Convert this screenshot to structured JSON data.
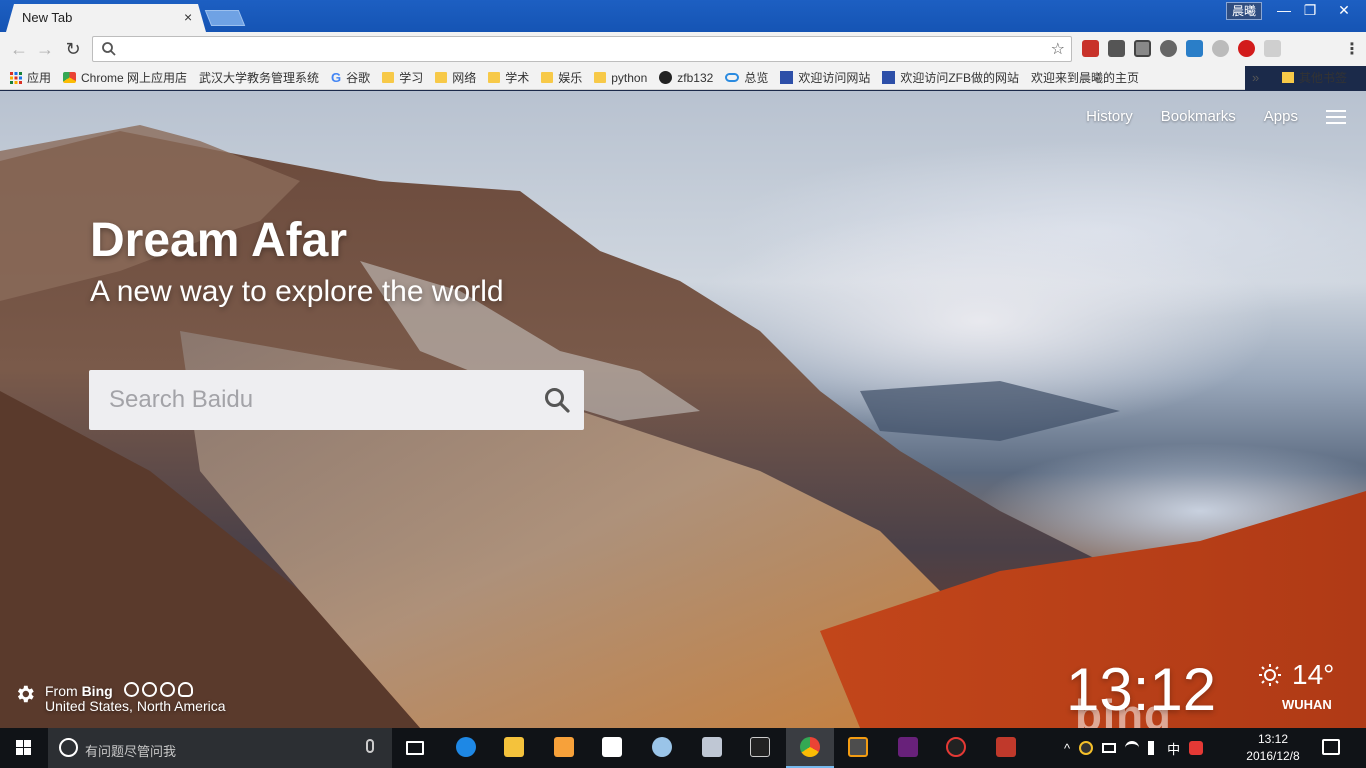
{
  "browser": {
    "tab_title": "New Tab",
    "tab_close": "×",
    "user_badge": "晨曦",
    "window_controls": {
      "minimize": "—",
      "maximize": "❐",
      "close": "✕"
    },
    "nav": {
      "back": "←",
      "forward": "→",
      "reload": "↻"
    },
    "star": "☆",
    "menu": "⋮"
  },
  "bookmarks": {
    "items": [
      {
        "label": "应用",
        "icon": "apps-grid-icon"
      },
      {
        "label": "Chrome 网上应用店",
        "icon": "chrome-store-icon"
      },
      {
        "label": "武汉大学教务管理系统",
        "icon": "page-icon"
      },
      {
        "label": "谷歌",
        "icon": "google-icon"
      },
      {
        "label": "学习",
        "icon": "folder-icon"
      },
      {
        "label": "网络",
        "icon": "folder-icon"
      },
      {
        "label": "学术",
        "icon": "folder-icon"
      },
      {
        "label": "娱乐",
        "icon": "folder-icon"
      },
      {
        "label": "python",
        "icon": "folder-icon"
      },
      {
        "label": "zfb132",
        "icon": "github-icon"
      },
      {
        "label": "总览",
        "icon": "cloud-icon"
      },
      {
        "label": "欢迎访问网站",
        "icon": "site-icon"
      },
      {
        "label": "欢迎访问ZFB做的网站",
        "icon": "site-icon"
      },
      {
        "label": "欢迎来到晨曦的主页",
        "icon": "page-icon"
      }
    ],
    "more": "»",
    "other": "其他书签"
  },
  "page": {
    "nav_links": [
      "History",
      "Bookmarks",
      "Apps"
    ],
    "headline": "Dream Afar",
    "tagline": "A new way to explore the world",
    "search_placeholder": "Search Baidu",
    "from_prefix": "From ",
    "from_source": "Bing",
    "location": "United States, North America",
    "clock": "13:12",
    "watermark": "bing",
    "temperature": "14°",
    "city": "WUHAN"
  },
  "taskbar": {
    "search_placeholder": "有问题尽管问我",
    "apps": [
      "task-view",
      "edge",
      "file-explorer",
      "paint",
      "store",
      "paint3d",
      "settings-app",
      "terminal",
      "chrome",
      "sublime",
      "visual-studio",
      "qq",
      "filezilla"
    ],
    "ime": "中",
    "time": "13:12",
    "date": "2016/12/8"
  },
  "colors": {
    "titlebar": "#1554b4",
    "search_box": "#eeeef1",
    "taskbar": "#101317",
    "accent": "#76b9ed"
  }
}
